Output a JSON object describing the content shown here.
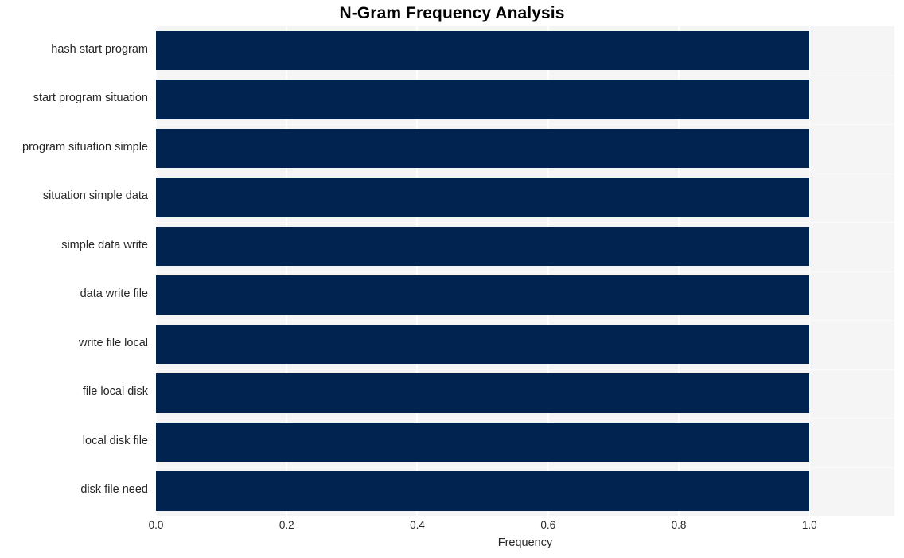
{
  "chart_data": {
    "type": "bar",
    "orientation": "horizontal",
    "title": "N-Gram Frequency Analysis",
    "xlabel": "Frequency",
    "ylabel": "",
    "categories": [
      "hash start program",
      "start program situation",
      "program situation simple",
      "situation simple data",
      "simple data write",
      "data write file",
      "write file local",
      "file local disk",
      "local disk file",
      "disk file need"
    ],
    "values": [
      1.0,
      1.0,
      1.0,
      1.0,
      1.0,
      1.0,
      1.0,
      1.0,
      1.0,
      1.0
    ],
    "xticks": [
      "0.0",
      "0.2",
      "0.4",
      "0.6",
      "0.8",
      "1.0"
    ],
    "xtick_values": [
      0.0,
      0.2,
      0.4,
      0.6,
      0.8,
      1.0
    ],
    "xlim": [
      0.0,
      1.13
    ],
    "grid": true,
    "legend": false,
    "bar_color": "#00234f",
    "plot_background": "#f5f5f5",
    "figure_background": "#ffffff",
    "gridline_color": "#ffffff",
    "text_color": "#262626"
  }
}
